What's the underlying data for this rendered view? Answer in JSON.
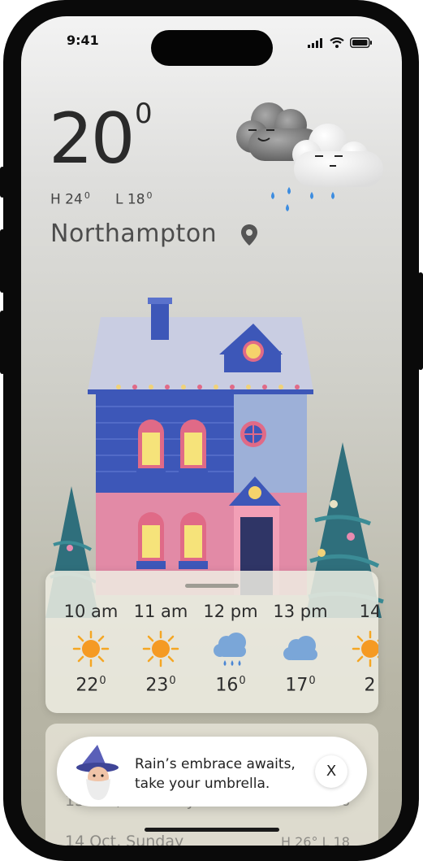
{
  "status_bar": {
    "time": "9:41"
  },
  "current": {
    "temperature": "20",
    "degree_symbol": "0",
    "high_label": "H 24",
    "high_deg": "0",
    "low_label": "L 18",
    "low_deg": "0",
    "city": "Northampton"
  },
  "hourly": [
    {
      "time": "10 am",
      "icon": "sun-icon",
      "temp": "22",
      "deg": "0"
    },
    {
      "time": "11 am",
      "icon": "sun-icon",
      "temp": "23",
      "deg": "0"
    },
    {
      "time": "12 pm",
      "icon": "rain-cloud-icon",
      "temp": "16",
      "deg": "0"
    },
    {
      "time": "13 pm",
      "icon": "cloud-icon",
      "temp": "17",
      "deg": "0"
    },
    {
      "time": "14",
      "icon": "sun-icon",
      "temp": "2",
      "deg": ""
    }
  ],
  "daily": [
    {
      "label": "13 Oct, Saturday",
      "hilo": "H 24° L 18"
    },
    {
      "label": "14 Oct, Sunday",
      "hilo": "H 26° L 18"
    }
  ],
  "toast": {
    "line1": "Rain’s embrace awaits,",
    "line2": "take your umbrella.",
    "close_label": "X"
  },
  "colors": {
    "sun": "#f5a623",
    "cloud_blue": "#7aa6d8",
    "house_blue": "#3d57b8",
    "house_pink": "#e28aa6",
    "tree": "#2f6f7c"
  }
}
